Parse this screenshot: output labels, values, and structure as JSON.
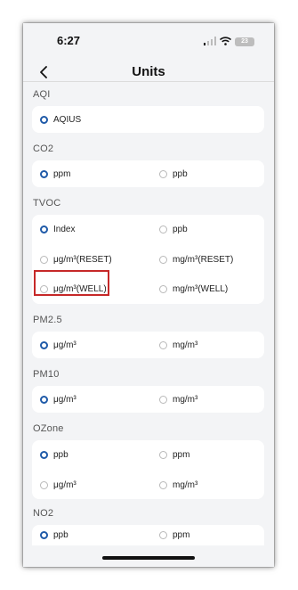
{
  "status": {
    "time": "6:27",
    "battery": "23"
  },
  "nav": {
    "title": "Units"
  },
  "sections": {
    "aqi": {
      "title": "AQI",
      "options": [
        {
          "label": "AQIUS",
          "checked": true
        }
      ]
    },
    "co2": {
      "title": "CO2",
      "options": [
        {
          "label": "ppm",
          "checked": true
        },
        {
          "label": "ppb",
          "checked": false
        }
      ]
    },
    "tvoc": {
      "title": "TVOC",
      "options": [
        {
          "label": "Index",
          "checked": true
        },
        {
          "label": "ppb",
          "checked": false
        },
        {
          "label": "μg/m³(RESET)",
          "checked": false
        },
        {
          "label": "mg/m³(RESET)",
          "checked": false
        },
        {
          "label": "μg/m³(WELL)",
          "checked": false
        },
        {
          "label": "mg/m³(WELL)",
          "checked": false
        }
      ]
    },
    "pm25": {
      "title": "PM2.5",
      "options": [
        {
          "label": "μg/m³",
          "checked": true
        },
        {
          "label": "mg/m³",
          "checked": false
        }
      ]
    },
    "pm10": {
      "title": "PM10",
      "options": [
        {
          "label": "μg/m³",
          "checked": true
        },
        {
          "label": "mg/m³",
          "checked": false
        }
      ]
    },
    "ozone": {
      "title": "OZone",
      "options": [
        {
          "label": "ppb",
          "checked": true
        },
        {
          "label": "ppm",
          "checked": false
        },
        {
          "label": "μg/m³",
          "checked": false
        },
        {
          "label": "mg/m³",
          "checked": false
        }
      ]
    },
    "no2": {
      "title": "NO2",
      "options": [
        {
          "label": "ppb",
          "checked": true
        },
        {
          "label": "ppm",
          "checked": false
        }
      ]
    }
  },
  "colors": {
    "accent": "#1f5aa8",
    "highlight": "#c62828",
    "background": "#f3f4f6"
  },
  "icons": {
    "back": "chevron-left-icon",
    "signal": "signal-icon",
    "wifi": "wifi-icon",
    "battery": "battery-icon"
  }
}
